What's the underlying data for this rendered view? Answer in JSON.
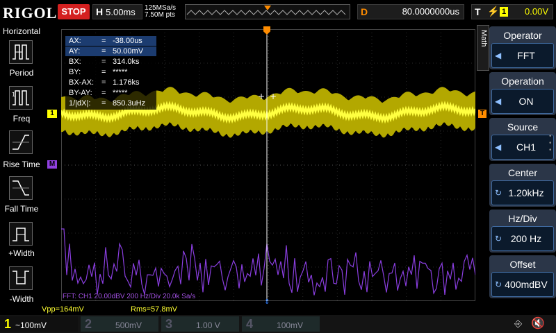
{
  "top": {
    "brand": "RIGOL",
    "run_state": "STOP",
    "timebase_key": "H",
    "timebase_value": "5.00ms",
    "sample_rate": "125MSa/s",
    "memory_depth": "7.50M pts",
    "delay_key": "D",
    "delay_value": "80.0000000us",
    "trigger_key": "T",
    "trigger_source": "1",
    "trigger_level": "0.00V"
  },
  "left_panel": {
    "title": "Horizontal",
    "items": [
      {
        "label": "Period"
      },
      {
        "label": "Freq"
      },
      {
        "label": "Rise Time"
      },
      {
        "label": "Fall Time"
      },
      {
        "label": "+Width"
      },
      {
        "label": "-Width"
      }
    ]
  },
  "measurements": {
    "rows": [
      {
        "key": "AX:",
        "value": "-38.00us",
        "highlight": true
      },
      {
        "key": "AY:",
        "value": "50.00mV",
        "highlight": true
      },
      {
        "key": "BX:",
        "value": "314.0ks",
        "highlight": false
      },
      {
        "key": "BY:",
        "value": "*****",
        "highlight": false
      },
      {
        "key": "BX-AX:",
        "value": "1.176ks",
        "highlight": false
      },
      {
        "key": "BY-AY:",
        "value": "*****",
        "highlight": false
      },
      {
        "key": "1/|dX|:",
        "value": "850.3uHz",
        "highlight": false
      }
    ],
    "eq": "="
  },
  "fft_info": "FFT: CH1  20.00dBV  200 Hz/Div  20.0k Sa/s",
  "vpp": "Vpp=164mV",
  "rms": "Rms=57.8mV",
  "markers": {
    "ch1": "1",
    "math": "M",
    "trig": "T"
  },
  "right_panel": {
    "tab": "Math",
    "sections": [
      {
        "title": "Operator",
        "value": "FFT"
      },
      {
        "title": "Operation",
        "value": "ON"
      },
      {
        "title": "Source",
        "value": "CH1"
      },
      {
        "title": "Center",
        "value": "1.20kHz"
      },
      {
        "title": "Hz/Div",
        "value": "200 Hz"
      },
      {
        "title": "Offset",
        "value": "400mdBV"
      }
    ]
  },
  "channels": [
    {
      "num": "1",
      "scale": "~100mV",
      "color": "#ffff00",
      "active": true
    },
    {
      "num": "2",
      "scale": "500mV",
      "color": "#00e0e0",
      "active": false
    },
    {
      "num": "3",
      "scale": "1.00 V",
      "color": "#e040e0",
      "active": false
    },
    {
      "num": "4",
      "scale": "100mV",
      "color": "#2f7fff",
      "active": false
    }
  ],
  "colors": {
    "ch1": "#ffff00",
    "math": "#9040e0",
    "accent": "#ff8c00"
  }
}
